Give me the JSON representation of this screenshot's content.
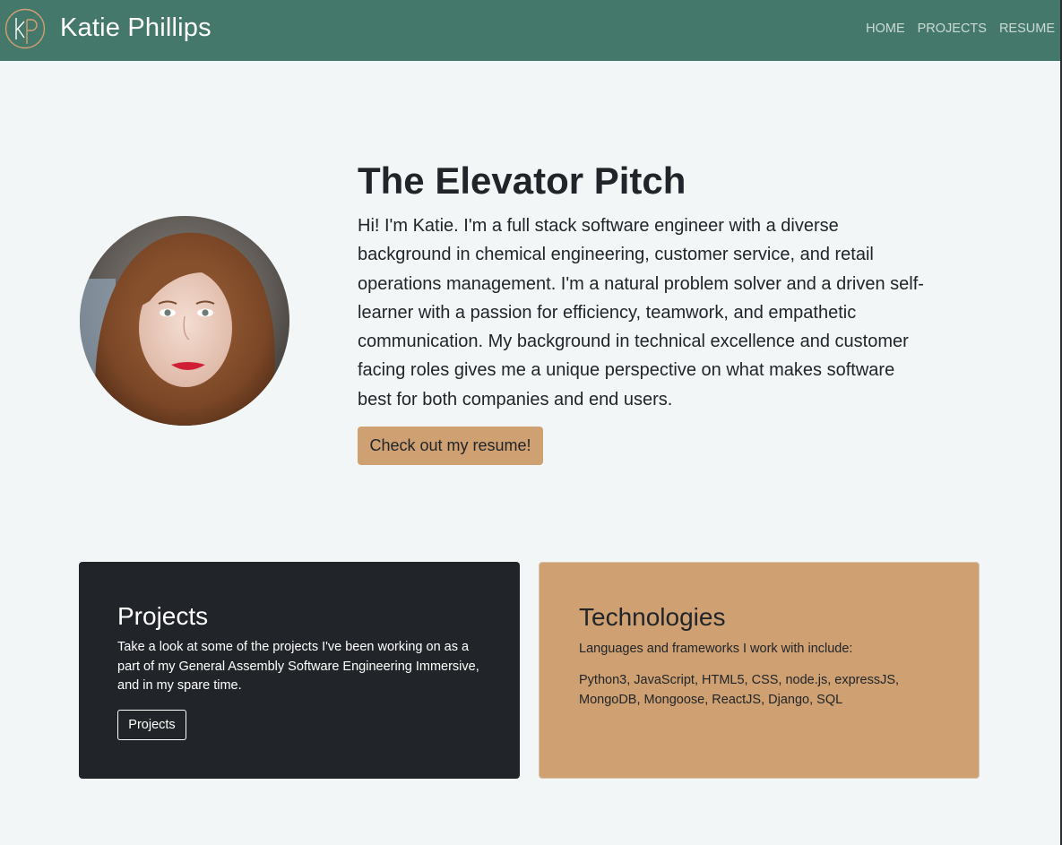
{
  "colors": {
    "navbar": "#44786a",
    "page_background": "#f3f6f6",
    "accent": "#cfa072",
    "dark_card": "#212529",
    "logo_stroke": "#cfa072"
  },
  "header": {
    "logo_icon": "kp-monogram-icon",
    "brand": "Katie Phillips",
    "nav": [
      "HOME",
      "PROJECTS",
      "RESUME"
    ]
  },
  "hero": {
    "avatar_icon": "profile-photo",
    "title": "The Elevator Pitch",
    "text": "Hi! I'm Katie. I'm a full stack software engineer with a diverse background in chemical engineering, customer service, and retail operations management. I'm a natural problem solver and a driven self-learner with a passion for efficiency, teamwork, and empathetic communication. My background in technical excellence and customer facing roles gives me a unique perspective on what makes software best for both companies and end users.",
    "button": "Check out my resume!"
  },
  "projects_card": {
    "title": "Projects",
    "text": "Take a look at some of the projects I've been working on as a part of my General Assembly Software Engineering Immersive, and in my spare time.",
    "button": "Projects"
  },
  "technologies_card": {
    "title": "Technologies",
    "intro": "Languages and frameworks I work with include:",
    "list": "Python3, JavaScript, HTML5, CSS, node.js, expressJS, MongoDB, Mongoose, ReactJS, Django, SQL"
  }
}
